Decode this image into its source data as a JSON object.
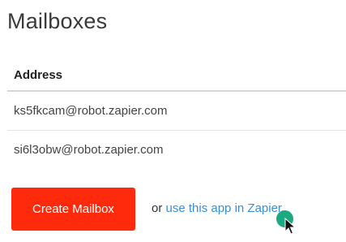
{
  "page": {
    "title": "Mailboxes"
  },
  "table": {
    "header": "Address",
    "rows": [
      "ks5fkcam@robot.zapier.com",
      "si6l3obw@robot.zapier.com"
    ]
  },
  "actions": {
    "create_label": "Create Mailbox",
    "or_text": "or ",
    "link_text": "use this app in Zapier",
    "period": "."
  },
  "colors": {
    "button_bg": "#ff2a0c",
    "link": "#3a8fd6",
    "cursor_dot": "#10a37a"
  },
  "icons": {
    "cursor": "mouse-pointer-icon"
  }
}
